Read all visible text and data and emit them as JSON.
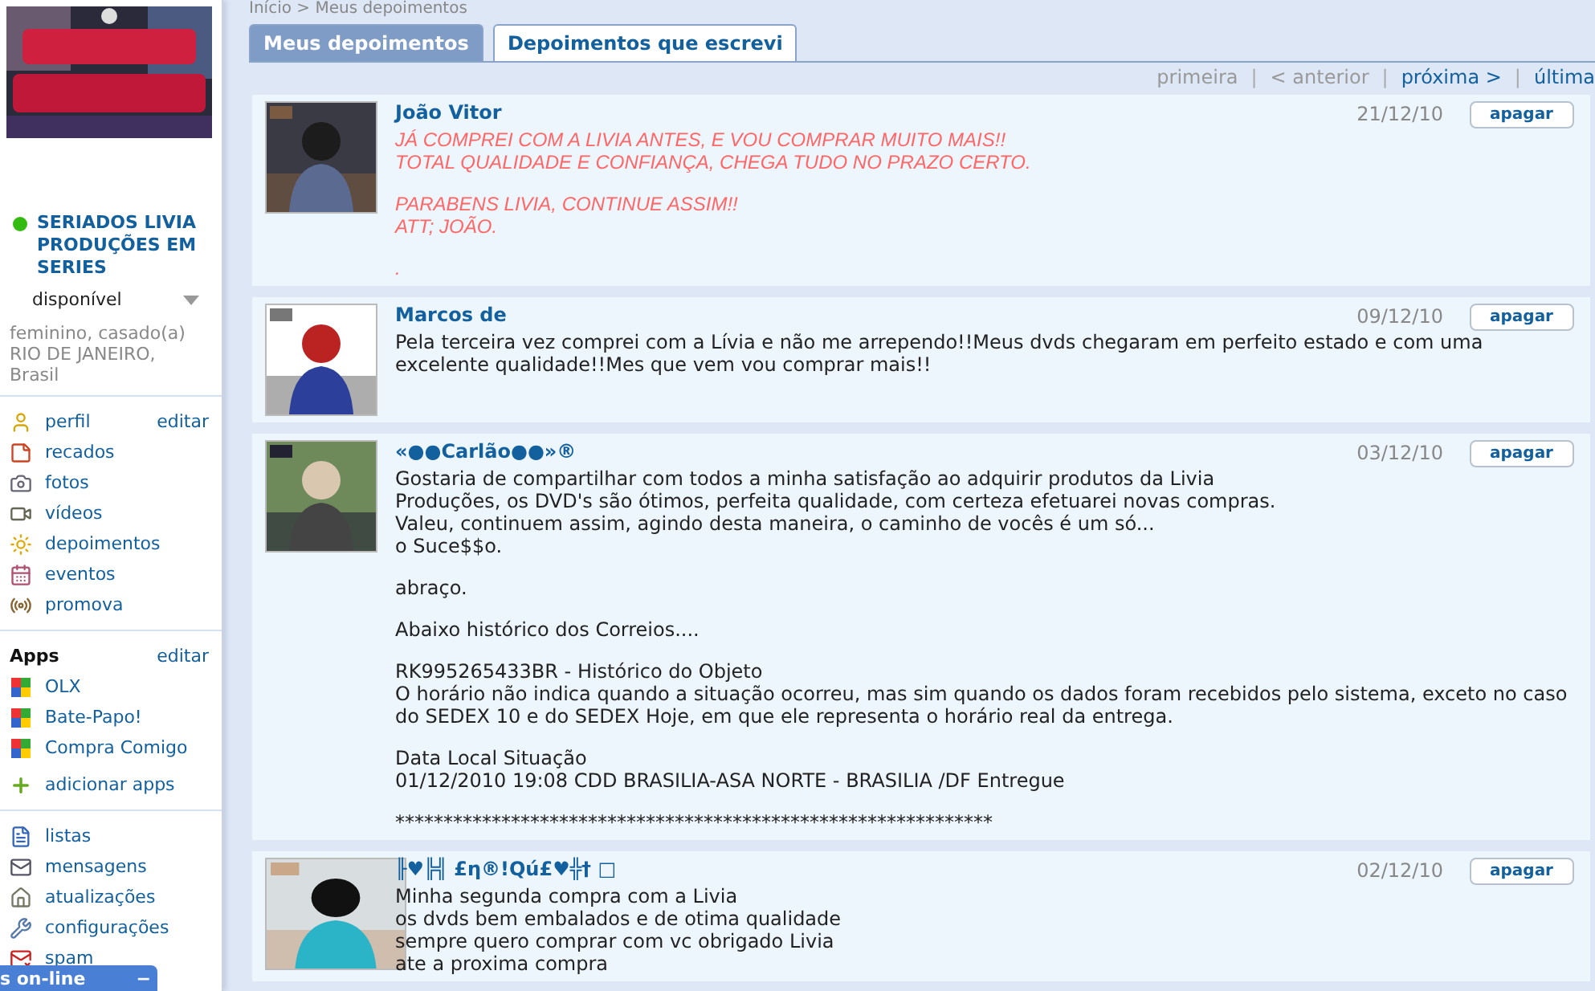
{
  "breadcrumb": "Início > Meus depoimentos",
  "profile": {
    "online": true,
    "name": "SERIADOS LIVIA PRODUÇÕES EM SERIES",
    "status": "disponível",
    "info": [
      "feminino, casado(a)",
      "RIO DE JANEIRO, Brasil"
    ]
  },
  "profile_menu": [
    {
      "label": "perfil",
      "edit": "editar"
    },
    {
      "label": "recados"
    },
    {
      "label": "fotos"
    },
    {
      "label": "vídeos"
    },
    {
      "label": "depoimentos"
    },
    {
      "label": "eventos"
    },
    {
      "label": "promova"
    }
  ],
  "apps": {
    "title": "Apps",
    "edit": "editar",
    "items": [
      "OLX",
      "Bate-Papo!",
      "Compra Comigo"
    ],
    "add": "adicionar apps"
  },
  "tools": [
    {
      "label": "listas"
    },
    {
      "label": "mensagens"
    },
    {
      "label": "atualizações"
    },
    {
      "label": "configurações"
    },
    {
      "label": "spam"
    }
  ],
  "online_bar": {
    "label": "s on-line",
    "collapse": "−"
  },
  "tabs": [
    {
      "label": "Meus depoimentos",
      "selected": true
    },
    {
      "label": "Depoimentos que escrevi",
      "selected": false
    }
  ],
  "pagination": [
    {
      "label": "primeira",
      "disabled": true
    },
    {
      "label": "< anterior",
      "disabled": true
    },
    {
      "label": "próxima >",
      "disabled": false
    },
    {
      "label": "última",
      "disabled": false
    }
  ],
  "pagination_separators": [
    "|",
    "|",
    "|"
  ],
  "testimonials": [
    {
      "author": "João Vitor",
      "date": "21/12/10",
      "action": "apagar",
      "kind": "styled",
      "paragraphs": [
        [
          "JÁ COMPREI COM A LIVIA ANTES, E VOU COMPRAR MUITO MAIS!!",
          "TOTAL QUALIDADE E CONFIANÇA, CHEGA TUDO NO PRAZO CERTO."
        ],
        [
          "PARABENS LIVIA, CONTINUE ASSIM!!",
          "ATT; JOÃO."
        ],
        [
          "."
        ]
      ]
    },
    {
      "author": "Marcos de",
      "date": "09/12/10",
      "action": "apagar",
      "kind": "plain",
      "paragraphs": [
        [
          "Pela terceira vez comprei com a Lívia e não me arrependo!!Meus dvds chegaram em perfeito estado e com uma excelente qualidade!!Mes que vem vou comprar mais!!"
        ]
      ]
    },
    {
      "author": "«●●Carlão●●»®",
      "date": "03/12/10",
      "action": "apagar",
      "kind": "plain",
      "paragraphs": [
        [
          "Gostaria de compartilhar com todos a minha satisfação ao adquirir produtos da Livia",
          "Produções, os DVD's são ótimos, perfeita qualidade, com certeza efetuarei novas compras.",
          "Valeu, continuem assim, agindo desta maneira, o caminho de vocês é um só...",
          "o Suce$$o."
        ],
        [
          "abraço."
        ],
        [
          "Abaixo histórico dos Correios...."
        ],
        [
          "RK995265433BR - Histórico do Objeto",
          "O horário não indica quando a situação ocorreu, mas sim quando os dados foram recebidos pelo sistema, exceto no caso do SEDEX 10 e do SEDEX Hoje, em que ele representa o horário real da entrega."
        ],
        [
          "Data Local Situação",
          "01/12/2010 19:08 CDD BRASILIA-ASA NORTE - BRASILIA /DF Entregue"
        ],
        [
          "**************************************************************"
        ]
      ]
    },
    {
      "author": "╟♥╠╣ £η®!Qú£♥╬† □",
      "date": "02/12/10",
      "action": "apagar",
      "kind": "plain",
      "paragraphs": [
        [
          "Minha segunda compra com a Livia",
          "os dvds bem embalados e de otima qualidade",
          "sempre quero comprar com vc obrigado Livia",
          "ate a proxima compra"
        ]
      ]
    }
  ]
}
